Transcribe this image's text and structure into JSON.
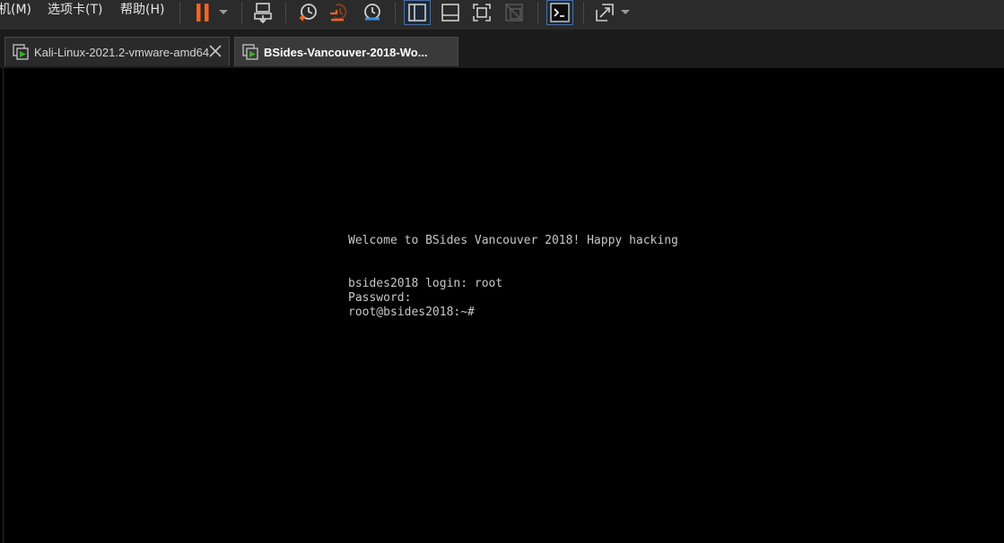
{
  "menu": {
    "items": [
      {
        "label": "机(M)"
      },
      {
        "label": "选项卡(T)"
      },
      {
        "label": "帮助(H)"
      }
    ]
  },
  "toolbar": {
    "icons": [
      "pause-icon",
      "dropdown-arrow-icon",
      "send-keys-icon",
      "snapshot-take-icon",
      "snapshot-revert-icon",
      "snapshot-manager-icon",
      "view-sidebar-icon",
      "view-thumbnail-icon",
      "fullscreen-icon",
      "unity-icon",
      "console-icon",
      "stretch-icon",
      "dropdown-arrow-icon"
    ],
    "accent_color": "#f26522"
  },
  "tabs": [
    {
      "label": "Kali-Linux-2021.2-vmware-amd64",
      "active": false
    },
    {
      "label": "BSides-Vancouver-2018-Wo...",
      "active": true
    }
  ],
  "console": {
    "lines": [
      "Welcome to BSides Vancouver 2018! Happy hacking",
      "bsides2018 login: root",
      "Password:",
      "root@bsides2018:~#"
    ]
  }
}
